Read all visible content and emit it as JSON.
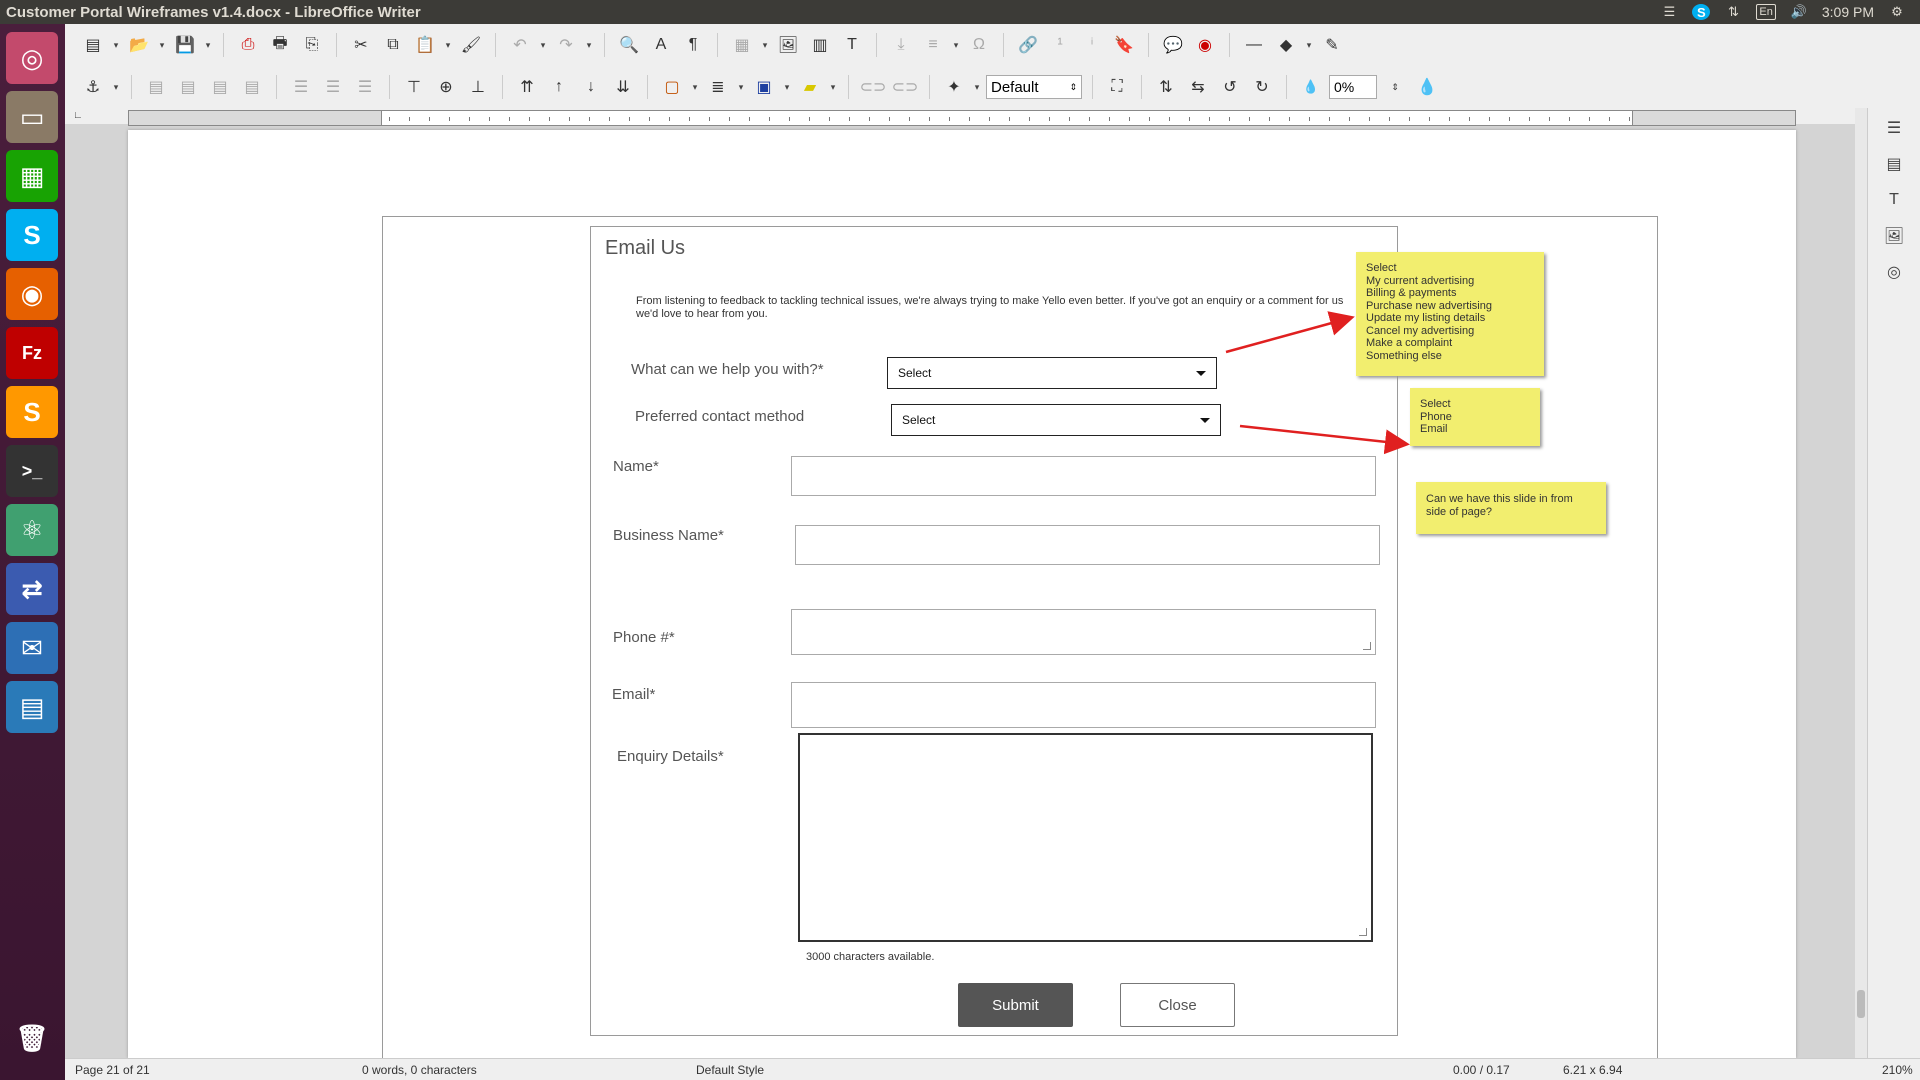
{
  "window": {
    "title": "Customer Portal Wireframes v1.4.docx - LibreOffice Writer"
  },
  "system_tray": {
    "language": "En",
    "clock": "3:09 PM"
  },
  "launcher": {
    "items": [
      {
        "name": "ubuntu-dash-icon",
        "glyph": "◎",
        "color": "#c34a6c"
      },
      {
        "name": "files-icon",
        "glyph": "▭",
        "color": "#8a7a66"
      },
      {
        "name": "libreoffice-calc-icon",
        "glyph": "▦",
        "color": "#18a303"
      },
      {
        "name": "skype-icon",
        "glyph": "S",
        "color": "#00aff0"
      },
      {
        "name": "firefox-icon",
        "glyph": "◉",
        "color": "#e66000"
      },
      {
        "name": "filezilla-icon",
        "glyph": "Fz",
        "color": "#bf0000"
      },
      {
        "name": "sublime-text-icon",
        "glyph": "S",
        "color": "#ff9800"
      },
      {
        "name": "terminal-icon",
        "glyph": ">_",
        "color": "#333"
      },
      {
        "name": "atom-icon",
        "glyph": "⚛",
        "color": "#40a070"
      },
      {
        "name": "remote-desktop-icon",
        "glyph": "⇄",
        "color": "#3b5bb0"
      },
      {
        "name": "thunderbird-icon",
        "glyph": "✉",
        "color": "#2d6fb5"
      },
      {
        "name": "libreoffice-writer-icon",
        "glyph": "▤",
        "color": "#2a7ab8"
      }
    ],
    "trash": {
      "glyph": "🗑"
    }
  },
  "toolbar2": {
    "paragraph_style": "Default",
    "transparency": "0%"
  },
  "document": {
    "form_title": "Email Us",
    "description": "From listening to feedback to tackling technical issues, we're always trying to make Yello even better. If you've got an enquiry or a comment for us we'd love to hear from you.",
    "help_label": "What can we help you with?*",
    "help_select": "Select",
    "contact_label": "Preferred contact method",
    "contact_select": "Select",
    "name_label": "Name*",
    "business_label": "Business Name*",
    "phone_label": "Phone #*",
    "email_label": "Email*",
    "enquiry_label": "Enquiry Details*",
    "chars_available": "3000 characters available.",
    "submit_label": "Submit",
    "close_label": "Close"
  },
  "notes": {
    "help_options": [
      "Select",
      "My current advertising",
      "Billing & payments",
      "Purchase new advertising",
      "Update my listing details",
      "Cancel my advertising",
      "Make a complaint",
      "Something else"
    ],
    "contact_options": [
      "Select",
      "Phone",
      "Email"
    ],
    "slide_note": "Can we have this slide in from side of page?"
  },
  "status_bar": {
    "page": "Page 21 of 21",
    "words": "0 words, 0 characters",
    "style": "Default Style",
    "position": "0.00 / 0.17",
    "size": "6.21 x 6.94",
    "zoom": "210%"
  },
  "colors": {
    "note": "#f2ee6f",
    "arrow": "#e02020",
    "submit_bg": "#555555"
  }
}
